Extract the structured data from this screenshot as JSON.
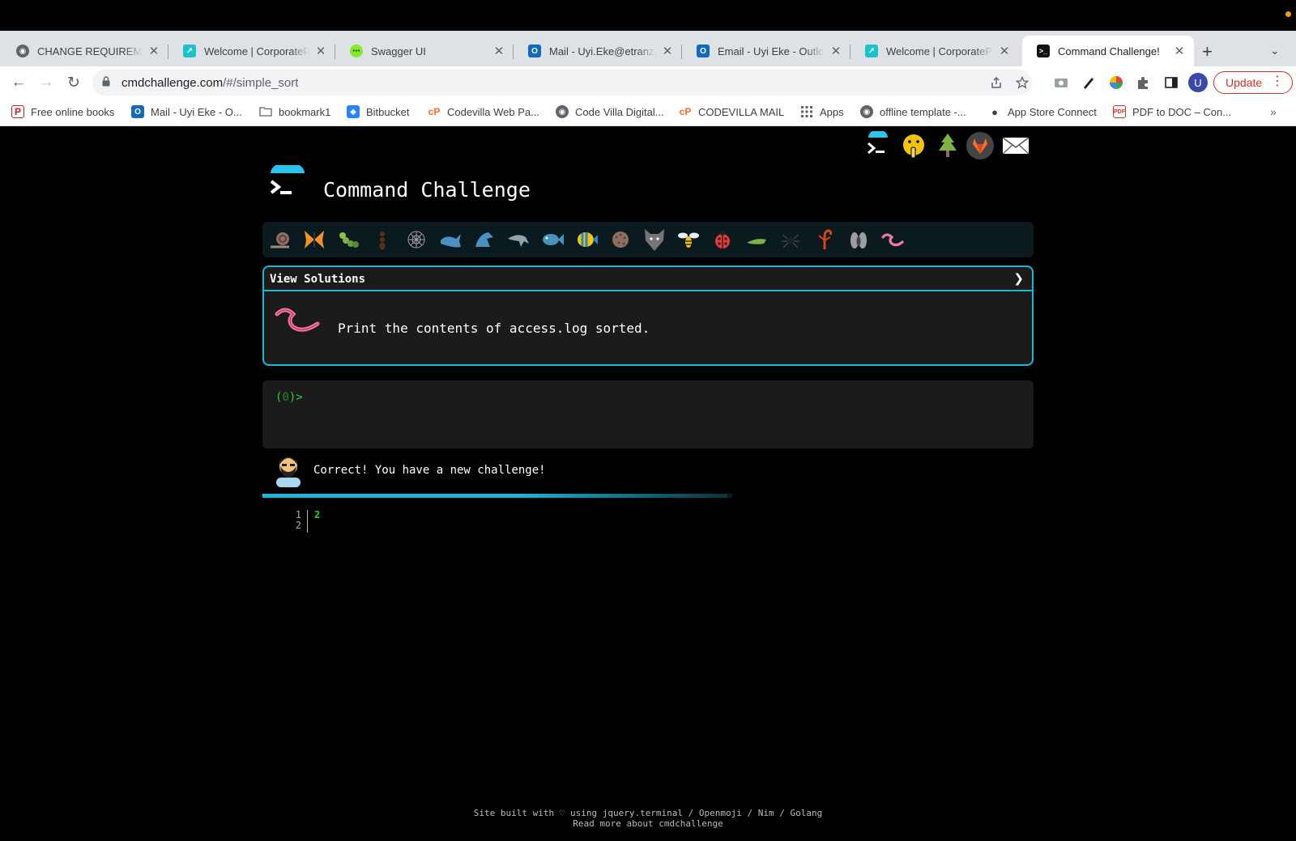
{
  "browser": {
    "tabs": [
      {
        "title": "CHANGE REQUIREMENTS",
        "icon": "globe-icon"
      },
      {
        "title": "Welcome | CorporatePay",
        "icon": "chart-icon"
      },
      {
        "title": "Swagger UI",
        "icon": "swagger-icon"
      },
      {
        "title": "Mail - Uyi.Eke@etranzact",
        "icon": "outlook-icon"
      },
      {
        "title": "Email - Uyi Eke - Outlook",
        "icon": "outlook-icon"
      },
      {
        "title": "Welcome | CorporatePay",
        "icon": "chart-icon"
      },
      {
        "title": "Command Challenge!",
        "icon": "terminal-icon",
        "active": true
      }
    ],
    "url_host": "cmdchallenge.com",
    "url_path": "/#/simple_sort",
    "update_label": "Update",
    "profile_initial": "U",
    "bookmarks": [
      {
        "label": "Free online books",
        "icon": "pdf-icon"
      },
      {
        "label": "Mail - Uyi Eke - O...",
        "icon": "outlook-icon"
      },
      {
        "label": "bookmark1",
        "icon": "folder-icon"
      },
      {
        "label": "Bitbucket",
        "icon": "bitbucket-icon"
      },
      {
        "label": "Codevilla Web Pa...",
        "icon": "cpanel-icon"
      },
      {
        "label": "Code Villa Digital...",
        "icon": "globe-icon"
      },
      {
        "label": "CODEVILLA MAIL",
        "icon": "cpanel-icon"
      },
      {
        "label": "Apps",
        "icon": "apps-grid-icon"
      },
      {
        "label": "offline template -...",
        "icon": "globe-icon"
      },
      {
        "label": "App Store Connect",
        "icon": "apple-icon"
      },
      {
        "label": "PDF to DOC – Con...",
        "icon": "pdf-doc-icon"
      }
    ],
    "colors": {
      "update_red": "#d93025",
      "tab_strip": "#dee1e6"
    }
  },
  "site": {
    "title": "Command Challenge",
    "top_icons": [
      "terminal-logo-icon",
      "shushing-face-icon",
      "tree-icon",
      "gitlab-icon",
      "envelope-icon"
    ],
    "levels": [
      "snail-icon",
      "butterfly-icon",
      "caterpillar-icon",
      "ant-icon",
      "web-icon",
      "whale-icon",
      "shark-icon",
      "dolphin-icon",
      "fish-icon",
      "tropical-fish-icon",
      "blowfish-icon",
      "wolf-icon",
      "bee-icon",
      "ladybug-icon",
      "cricket-icon",
      "spider-icon",
      "scorpion-icon",
      "fly-icon",
      "worm-icon"
    ],
    "view_solutions": "View Solutions",
    "task": "Print the contents of access.log sorted.",
    "prompt_open": "(",
    "prompt_count": "0",
    "prompt_close": ")>",
    "feedback": "Correct! You have a new challenge!",
    "progress": 0.99,
    "output_lines": [
      "1",
      "2"
    ],
    "output_text": "2",
    "footer_line1": "Site built with ♡ using jquery.terminal / Openmoji / Nim / Golang",
    "footer_line2": "Read more about cmdchallenge",
    "colors": {
      "accent": "#1ab6d8",
      "prompt_green": "#22d33a"
    }
  }
}
